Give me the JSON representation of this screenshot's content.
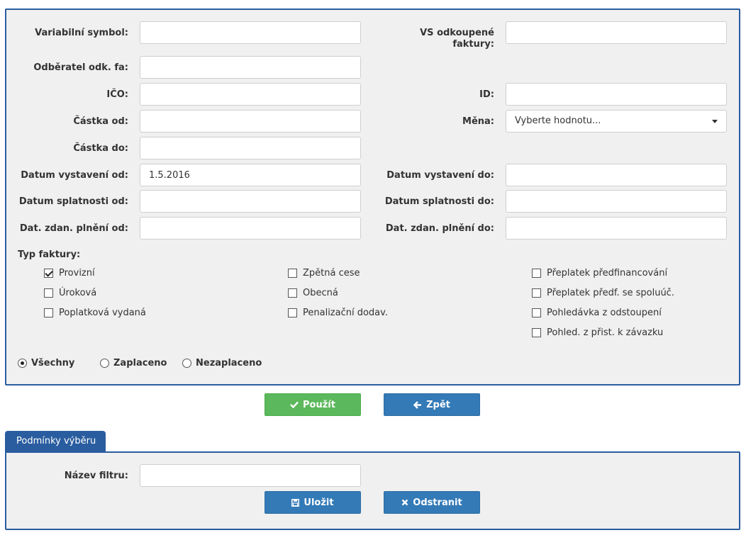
{
  "fields": {
    "variabilni_symbol": {
      "label": "Variabilní symbol:",
      "value": ""
    },
    "vs_odkoupene": {
      "label_line1": "VS odkoupené",
      "label_line2": "faktury:",
      "value": ""
    },
    "odberatel": {
      "label": "Odběratel odk. fa:",
      "value": ""
    },
    "ico": {
      "label": "IČO:",
      "value": ""
    },
    "id": {
      "label": "ID:",
      "value": ""
    },
    "castka_od": {
      "label": "Částka od:",
      "value": ""
    },
    "mena": {
      "label": "Měna:",
      "selected": "Vyberte hodnotu..."
    },
    "castka_do": {
      "label": "Částka do:",
      "value": ""
    },
    "datum_vystaveni_od": {
      "label": "Datum vystavení od:",
      "value": "1.5.2016"
    },
    "datum_vystaveni_do": {
      "label": "Datum vystavení do:",
      "value": ""
    },
    "datum_splatnosti_od": {
      "label": "Datum splatnosti od:",
      "value": ""
    },
    "datum_splatnosti_do": {
      "label": "Datum splatnosti do:",
      "value": ""
    },
    "dat_zdan_od": {
      "label": "Dat. zdan. plnění od:",
      "value": ""
    },
    "dat_zdan_do": {
      "label": "Dat. zdan. plnění do:",
      "value": ""
    }
  },
  "typ_faktury": {
    "title": "Typ faktury:",
    "options": [
      {
        "label": "Provizní",
        "checked": true
      },
      {
        "label": "Úroková",
        "checked": false
      },
      {
        "label": "Poplatková vydaná",
        "checked": false
      },
      {
        "label": "Zpětná cese",
        "checked": false
      },
      {
        "label": "Obecná",
        "checked": false
      },
      {
        "label": "Penalizační dodav.",
        "checked": false
      },
      {
        "label": "Přeplatek předfinancování",
        "checked": false
      },
      {
        "label": "Přeplatek předf. se spoluúč.",
        "checked": false
      },
      {
        "label": "Pohledávka z odstoupení",
        "checked": false
      },
      {
        "label": "Pohled. z přist. k závazku",
        "checked": false
      }
    ]
  },
  "payment_status": {
    "options": [
      {
        "label": "Všechny",
        "checked": true
      },
      {
        "label": "Zaplaceno",
        "checked": false
      },
      {
        "label": "Nezaplaceno",
        "checked": false
      }
    ]
  },
  "actions": {
    "apply_label": "Použít",
    "back_label": "Zpět"
  },
  "filter_tab": {
    "label": "Podmínky výběru",
    "name_label": "Název filtru:",
    "name_value": "",
    "save_label": "Uložit",
    "delete_label": "Odstranit"
  },
  "colors": {
    "panel_border": "#2a5d9f",
    "green_button": "#5cb85c",
    "blue_button": "#337ab7"
  }
}
